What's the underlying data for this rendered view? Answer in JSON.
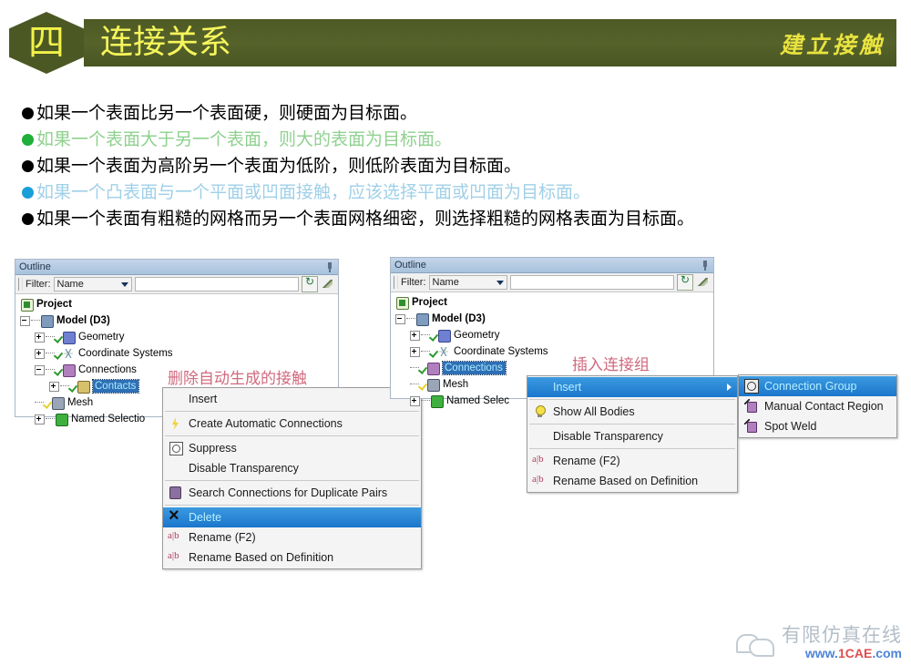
{
  "header": {
    "badge": "四",
    "title": "连接关系",
    "subtitle": "建立接触",
    "bar_color": "#4e5a24",
    "title_color": "#f6f65c"
  },
  "bullets": [
    {
      "color": "#000000",
      "style": "black",
      "text": "如果一个表面比另一个表面硬，则硬面为目标面。"
    },
    {
      "color": "#1faf3a",
      "style": "green",
      "text": "如果一个表面大于另一个表面，则大的表面为目标面。"
    },
    {
      "color": "#000000",
      "style": "black",
      "text": "如果一个表面为高阶另一个表面为低阶，则低阶表面为目标面。"
    },
    {
      "color": "#1b9fd8",
      "style": "blue",
      "text": "如果一个凸表面与一个平面或凹面接触，应该选择平面或凹面为目标面。"
    },
    {
      "color": "#000000",
      "style": "black",
      "text": "如果一个表面有粗糙的网格而另一个表面网格细密，则选择粗糙的网格表面为目标面。"
    }
  ],
  "left_panel": {
    "title": "Outline",
    "pin": "pin-icon",
    "filter": {
      "label": "Filter:",
      "select_value": "Name",
      "input_value": "",
      "input_placeholder": "",
      "refresh": "refresh-icon",
      "brush": "brush-icon"
    },
    "tree": [
      {
        "label": "Project",
        "bold": true,
        "indent": 0,
        "expander": "none",
        "icon": "project-icon",
        "check": "none",
        "selected": false
      },
      {
        "label": "Model (D3)",
        "bold": true,
        "indent": 1,
        "expander": "minus",
        "icon": "model-icon",
        "check": "none",
        "selected": false
      },
      {
        "label": "Geometry",
        "bold": false,
        "indent": 2,
        "expander": "plus",
        "icon": "geometry-icon",
        "check": "green",
        "selected": false
      },
      {
        "label": "Coordinate Systems",
        "bold": false,
        "indent": 2,
        "expander": "plus",
        "icon": "coordinate-systems-icon",
        "check": "green",
        "selected": false
      },
      {
        "label": "Connections",
        "bold": false,
        "indent": 2,
        "expander": "minus",
        "icon": "connections-icon",
        "check": "green",
        "selected": false
      },
      {
        "label": "Contacts",
        "bold": false,
        "indent": 3,
        "expander": "plus",
        "icon": "contacts-icon",
        "check": "green",
        "selected": true
      },
      {
        "label": "Mesh",
        "bold": false,
        "indent": 2,
        "expander": "none",
        "icon": "mesh-icon",
        "check": "yellow",
        "selected": false
      },
      {
        "label": "Named Selectio",
        "bold": false,
        "indent": 2,
        "expander": "plus",
        "icon": "named-selections-icon",
        "check": "none",
        "selected": false
      }
    ]
  },
  "right_panel": {
    "title": "Outline",
    "pin": "pin-icon",
    "filter": {
      "label": "Filter:",
      "select_value": "Name",
      "input_value": "",
      "input_placeholder": "",
      "refresh": "refresh-icon",
      "brush": "brush-icon"
    },
    "tree": [
      {
        "label": "Project",
        "bold": true,
        "indent": 0,
        "expander": "none",
        "icon": "project-icon",
        "check": "none",
        "selected": false
      },
      {
        "label": "Model (D3)",
        "bold": true,
        "indent": 1,
        "expander": "minus",
        "icon": "model-icon",
        "check": "none",
        "selected": false
      },
      {
        "label": "Geometry",
        "bold": false,
        "indent": 2,
        "expander": "plus",
        "icon": "geometry-icon",
        "check": "green",
        "selected": false
      },
      {
        "label": "Coordinate Systems",
        "bold": false,
        "indent": 2,
        "expander": "plus",
        "icon": "coordinate-systems-icon",
        "check": "green",
        "selected": false
      },
      {
        "label": "Connections",
        "bold": false,
        "indent": 2,
        "expander": "none",
        "icon": "connections-icon",
        "check": "green",
        "selected": true
      },
      {
        "label": "Mesh",
        "bold": false,
        "indent": 2,
        "expander": "none",
        "icon": "mesh-icon",
        "check": "yellow",
        "selected": false
      },
      {
        "label": "Named Selec",
        "bold": false,
        "indent": 2,
        "expander": "plus",
        "icon": "named-selections-icon",
        "check": "none",
        "selected": false
      }
    ]
  },
  "left_menu": {
    "items": [
      {
        "label": "Insert",
        "icon": "none",
        "submenu": true,
        "highlight": false,
        "sep_after": true
      },
      {
        "label": "Create Automatic Connections",
        "icon": "bolt-icon",
        "submenu": false,
        "highlight": false,
        "sep_after": true
      },
      {
        "label": "Suppress",
        "icon": "suppress-icon",
        "submenu": false,
        "highlight": false,
        "sep_after": false
      },
      {
        "label": "Disable Transparency",
        "icon": "none",
        "submenu": false,
        "highlight": false,
        "sep_after": true
      },
      {
        "label": "Search Connections for Duplicate Pairs",
        "icon": "search-icon",
        "submenu": false,
        "highlight": false,
        "sep_after": true
      },
      {
        "label": "Delete",
        "icon": "delete-icon",
        "submenu": false,
        "highlight": true,
        "sep_after": false
      },
      {
        "label": "Rename (F2)",
        "icon": "rename-icon",
        "submenu": false,
        "highlight": false,
        "sep_after": false
      },
      {
        "label": "Rename Based on Definition",
        "icon": "rename-icon",
        "submenu": false,
        "highlight": false,
        "sep_after": false
      }
    ]
  },
  "right_menu": {
    "items": [
      {
        "label": "Insert",
        "icon": "none",
        "submenu": true,
        "highlight": true,
        "sep_after": true
      },
      {
        "label": "Show All Bodies",
        "icon": "bulb-icon",
        "submenu": false,
        "highlight": false,
        "sep_after": true
      },
      {
        "label": "Disable Transparency",
        "icon": "none",
        "submenu": false,
        "highlight": false,
        "sep_after": true
      },
      {
        "label": "Rename (F2)",
        "icon": "rename-icon",
        "submenu": false,
        "highlight": false,
        "sep_after": false
      },
      {
        "label": "Rename Based on Definition",
        "icon": "rename-icon",
        "submenu": false,
        "highlight": false,
        "sep_after": false
      }
    ]
  },
  "right_submenu": {
    "items": [
      {
        "label": "Connection Group",
        "icon": "connection-group-icon",
        "highlight": true
      },
      {
        "label": "Manual Contact Region",
        "icon": "manual-contact-region-icon",
        "highlight": false
      },
      {
        "label": "Spot Weld",
        "icon": "spot-weld-icon",
        "highlight": false
      }
    ]
  },
  "annotations": [
    {
      "text": "删除自动生成的接触",
      "color": "#d06a7e"
    },
    {
      "text": "插入连接组",
      "color": "#d06a7e"
    }
  ],
  "watermark": {
    "big": "1CAE.COM"
  },
  "footer": {
    "logo": "wechat-logo-icon",
    "cn_text": "有限仿真在线",
    "url_prefix": "www.",
    "url_main": "1CAE",
    "url_suffix": ".com"
  }
}
